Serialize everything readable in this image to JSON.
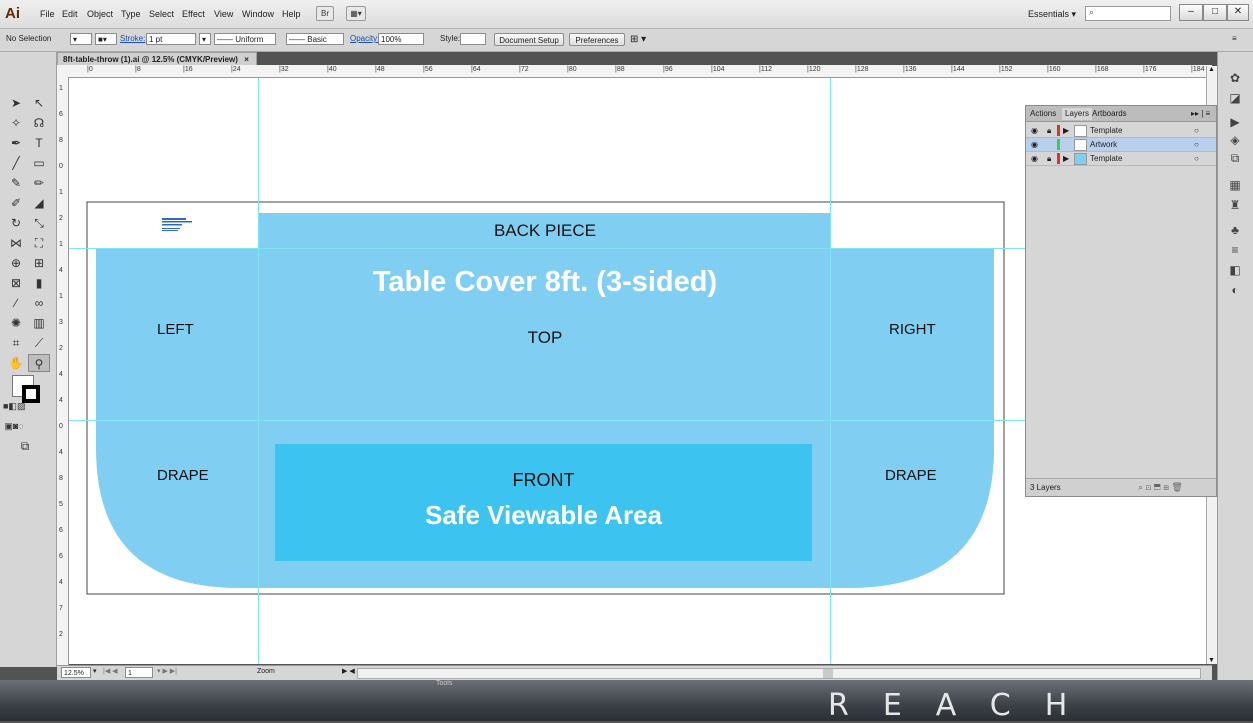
{
  "app": {
    "logo": "Ai",
    "menu": [
      "File",
      "Edit",
      "Object",
      "Type",
      "Select",
      "Effect",
      "View",
      "Window",
      "Help"
    ],
    "bridge_btn": "Br",
    "workspace": "Essentials",
    "workspace_caret": "▾",
    "window_buttons": [
      "–",
      "□",
      "✕"
    ]
  },
  "control_bar": {
    "selection": "No Selection",
    "stroke_label": "Stroke:",
    "stroke_value": "1 pt",
    "uniform": "Uniform",
    "basic": "Basic",
    "opacity_label": "Opacity:",
    "opacity_value": "100%",
    "style_label": "Style:",
    "doc_setup": "Document Setup",
    "preferences": "Preferences"
  },
  "document": {
    "tab_title": "8ft-table-throw (1).ai @ 12.5% (CMYK/Preview)",
    "tab_close": "×"
  },
  "rulers": {
    "h_ticks": [
      "0",
      "8",
      "16",
      "24",
      "32",
      "40",
      "48",
      "56",
      "64",
      "72",
      "80",
      "88",
      "96",
      "104",
      "112",
      "120",
      "128",
      "136",
      "144",
      "152",
      "160",
      "168",
      "176",
      "184"
    ],
    "v_ticks": [
      "1",
      "6",
      "8",
      "0",
      "1",
      "2",
      "1",
      "4",
      "1",
      "3",
      "2",
      "4",
      "4",
      "0",
      "4",
      "8",
      "5",
      "6",
      "6",
      "4",
      "7",
      "2"
    ]
  },
  "artboard": {
    "back_piece": "BACK PIECE",
    "title": "Table Cover 8ft. (3-sided)",
    "left": "LEFT",
    "top": "TOP",
    "right": "RIGHT",
    "drape_left": "DRAPE",
    "drape_right": "DRAPE",
    "front": "FRONT",
    "safe_area": "Safe Viewable Area",
    "note_line1": "Table Cover - 8 Panels",
    "note_line2": "Blueprint Template",
    "note_line3": "100% - tiny specs",
    "colors": {
      "cover": "#80cff3",
      "safe": "#3dc3ef",
      "back": "#80cff3",
      "guide": "#7fe4f2"
    }
  },
  "status_bar": {
    "zoom_value": "12.5%",
    "artboard_num": "1",
    "zoom_label": "Zoom"
  },
  "layers_panel": {
    "tabs": [
      "Actions",
      "Layers",
      "Artboards"
    ],
    "layers": [
      {
        "name": "Template",
        "color": "#e03030"
      },
      {
        "name": "Artwork",
        "color": "#3ccf3c"
      },
      {
        "name": "Template",
        "color": "#e03030"
      }
    ],
    "count": "3 Layers"
  },
  "taskbar": {
    "tools_label": "Tools",
    "wallpaper_text": "REACH"
  }
}
